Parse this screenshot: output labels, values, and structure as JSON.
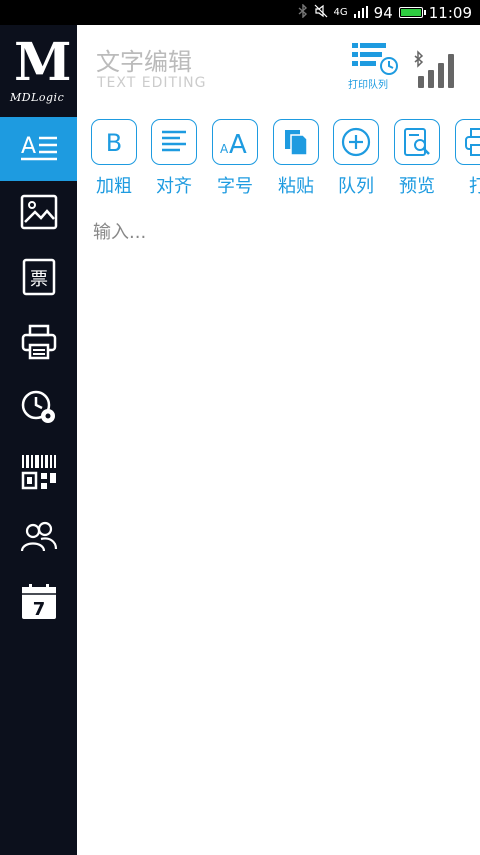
{
  "status": {
    "network": "4G",
    "battery_text": "94",
    "battery_level": 0.94,
    "time": "11:09"
  },
  "app": {
    "logo_big": "M",
    "logo_small": "MDLogic"
  },
  "header": {
    "title": "文字编辑",
    "subtitle": "TEXT EDITING",
    "queue_label": "打印队列"
  },
  "sidebar": {
    "items": [
      {
        "icon": "text-edit-icon",
        "active": true
      },
      {
        "icon": "image-icon",
        "active": false
      },
      {
        "icon": "ticket-icon",
        "active": false
      },
      {
        "icon": "printer-icon",
        "active": false
      },
      {
        "icon": "settings-clock-icon",
        "active": false
      },
      {
        "icon": "barcode-qr-icon",
        "active": false
      },
      {
        "icon": "users-icon",
        "active": false
      },
      {
        "icon": "calendar-icon",
        "active": false,
        "text": "7"
      }
    ]
  },
  "toolbar": {
    "items": [
      {
        "label": "加粗",
        "icon": "bold-icon",
        "glyph": "B"
      },
      {
        "label": "对齐",
        "icon": "align-icon"
      },
      {
        "label": "字号",
        "icon": "font-size-icon",
        "glyph": "A"
      },
      {
        "label": "粘贴",
        "icon": "paste-icon"
      },
      {
        "label": "队列",
        "icon": "add-queue-icon"
      },
      {
        "label": "预览",
        "icon": "preview-icon"
      },
      {
        "label": "打",
        "icon": "print-icon"
      }
    ]
  },
  "editor": {
    "placeholder": "输入..."
  },
  "colors": {
    "accent": "#1e9be0",
    "sidebar_bg": "#0c101c"
  }
}
